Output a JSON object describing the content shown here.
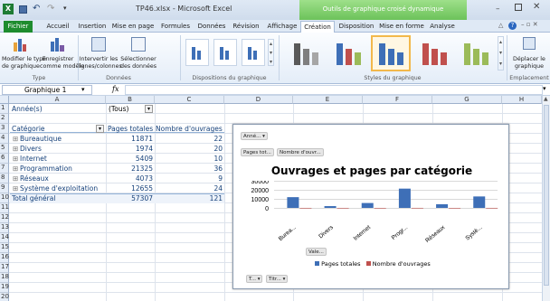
{
  "window": {
    "title": "TP46.xlsx - Microsoft Excel",
    "context_tab": "Outils de graphique croisé dynamique"
  },
  "tabs": [
    "Fichier",
    "Accueil",
    "Insertion",
    "Mise en page",
    "Formules",
    "Données",
    "Révision",
    "Affichage",
    "Création",
    "Disposition",
    "Mise en forme",
    "Analyse"
  ],
  "ribbon": {
    "change_type": "Modifier le type\nde graphique",
    "save_template": "Enregistrer\ncomme modèle",
    "group_type": "Type",
    "switch_rows": "Intervertir les\nlignes/colonnes",
    "select_data": "Sélectionner\ndes données",
    "group_data": "Données",
    "group_layouts": "Dispositions du graphique",
    "group_styles": "Styles du graphique",
    "move_chart": "Déplacer le\ngraphique",
    "group_location": "Emplacement"
  },
  "formula_bar": {
    "name_box": "Graphique 1",
    "fx": "fx",
    "value": ""
  },
  "columns": [
    "A",
    "B",
    "C",
    "D",
    "E",
    "F",
    "G",
    "H"
  ],
  "rows": [
    "1",
    "2",
    "3",
    "4",
    "5",
    "6",
    "7",
    "8",
    "9",
    "10",
    "11",
    "12",
    "13",
    "14",
    "15",
    "16",
    "17",
    "18",
    "19",
    "20"
  ],
  "pivot": {
    "filter_label": "Année(s)",
    "filter_value": "(Tous)",
    "headers": [
      "Catégorie",
      "Pages totales",
      "Nombre d'ouvrages"
    ],
    "items": [
      {
        "name": "Bureautique",
        "pages": "11871",
        "count": "22"
      },
      {
        "name": "Divers",
        "pages": "1974",
        "count": "20"
      },
      {
        "name": "Internet",
        "pages": "5409",
        "count": "10"
      },
      {
        "name": "Programmation",
        "pages": "21325",
        "count": "36"
      },
      {
        "name": "Réseaux",
        "pages": "4073",
        "count": "9"
      },
      {
        "name": "Système d'exploitation",
        "pages": "12655",
        "count": "24"
      }
    ],
    "total": {
      "name": "Total général",
      "pages": "57307",
      "count": "121"
    }
  },
  "chart_buttons": {
    "year": "Anné...",
    "pages": "Pages tot...",
    "count": "Nombre d'ouvr...",
    "values": "Vale...",
    "type": "T...",
    "title": "Titr..."
  },
  "chart_data": {
    "type": "bar",
    "title": "Ouvrages et pages par catégorie",
    "categories": [
      "Burea...",
      "Divers",
      "Internet",
      "Progr...",
      "Réseaux",
      "Systè..."
    ],
    "series": [
      {
        "name": "Pages totales",
        "color": "#3e6fb7",
        "values": [
          11871,
          1974,
          5409,
          21325,
          4073,
          12655
        ]
      },
      {
        "name": "Nombre d'ouvrages",
        "color": "#c0504d",
        "values": [
          22,
          20,
          10,
          36,
          9,
          24
        ]
      }
    ],
    "yticks": [
      "30000",
      "20000",
      "10000",
      "0"
    ],
    "ylim": [
      0,
      30000
    ],
    "legend": "bottom"
  }
}
